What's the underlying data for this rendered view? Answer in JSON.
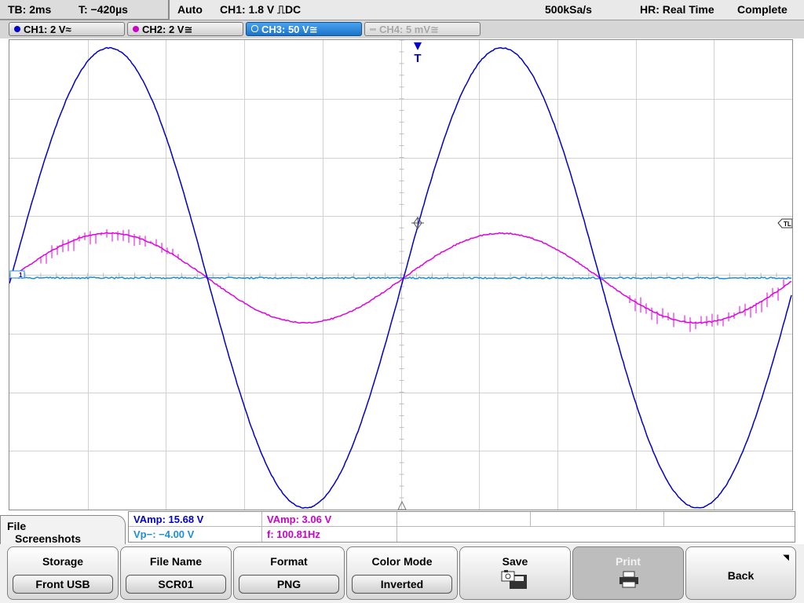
{
  "status": {
    "timebase": "TB: 2ms",
    "delay": "T: −420µs",
    "trigger_mode": "Auto",
    "trigger": "CH1: 1.8 V ⎍DC",
    "sample_rate": "500kSa/s",
    "acq_mode": "HR: Real Time",
    "acq_state": "Complete"
  },
  "channels": [
    {
      "label": "CH1: 2 V",
      "coupling_icon": "≈",
      "color": "#0000cc",
      "active": false,
      "enabled": true
    },
    {
      "label": "CH2: 2 V",
      "coupling_icon": "≅",
      "color": "#cc00cc",
      "active": false,
      "enabled": true
    },
    {
      "label": "CH3: 50 V",
      "coupling_icon": "≅",
      "color": "#ffffff",
      "active": true,
      "enabled": true
    },
    {
      "label": "CH4: 5 mV",
      "coupling_icon": "≅",
      "color": "#a8a8a8",
      "active": false,
      "enabled": false
    }
  ],
  "markers": {
    "trigger_marker": "T",
    "trigger_level_marker": "TL",
    "ground_marker": "1"
  },
  "measurements": [
    {
      "text": "VAmp: 15.68 V",
      "color": "#0000cc"
    },
    {
      "text": "VAmp: 3.06 V",
      "color": "#cc00cc"
    },
    {
      "text": "Vp−: −4.00 V",
      "color": "#1d8fd8"
    },
    {
      "text": "f: 100.81Hz",
      "color": "#cc00cc"
    }
  ],
  "menu": {
    "line1": "File",
    "line2": "Screenshots"
  },
  "softkeys": {
    "storage": {
      "title": "Storage",
      "value": "Front USB"
    },
    "file_name": {
      "title": "File Name",
      "value": "SCR01"
    },
    "format": {
      "title": "Format",
      "value": "PNG"
    },
    "color_mode": {
      "title": "Color Mode",
      "value": "Inverted"
    },
    "save": {
      "title": "Save",
      "icon": "save-disk-icon"
    },
    "print": {
      "title": "Print",
      "icon": "printer-icon"
    },
    "back": {
      "title": "Back"
    }
  },
  "waveform_colors": {
    "ch1": "#0000cc",
    "ch2": "#e000e0",
    "ch3": "#1d8fd8"
  }
}
